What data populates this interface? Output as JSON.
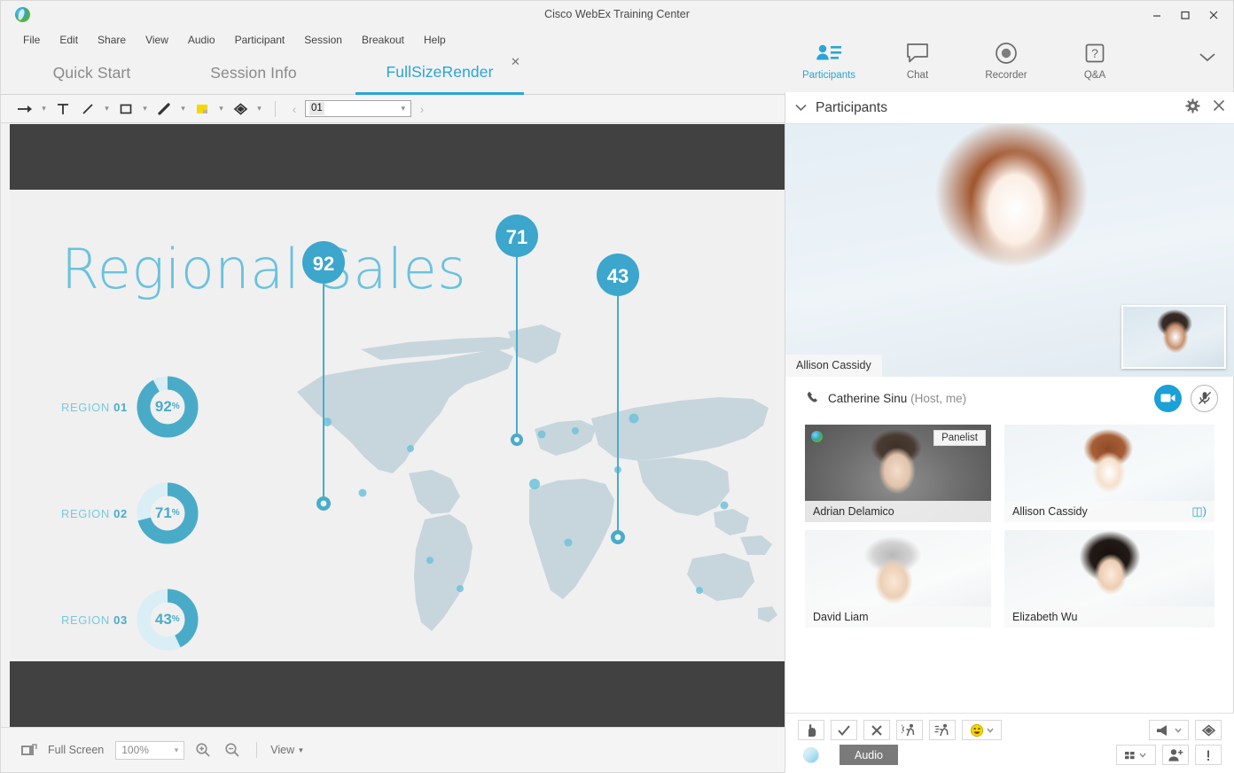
{
  "window": {
    "title": "Cisco WebEx Training Center",
    "logo_icon": "webex-logo-icon",
    "minimize_icon": "minimize-icon",
    "maximize_icon": "maximize-icon",
    "close_icon": "close-icon"
  },
  "menu": {
    "items": [
      "File",
      "Edit",
      "Share",
      "View",
      "Audio",
      "Participant",
      "Session",
      "Breakout",
      "Help"
    ]
  },
  "tabs": {
    "items": [
      {
        "label": "Quick Start",
        "active": false
      },
      {
        "label": "Session Info",
        "active": false
      },
      {
        "label": "FullSizeRender",
        "active": true
      }
    ],
    "close_icon": "close-icon"
  },
  "tool_icons": [
    {
      "label": "Participants",
      "icon": "participants-icon",
      "active": true
    },
    {
      "label": "Chat",
      "icon": "chat-bubble-icon",
      "active": false
    },
    {
      "label": "Recorder",
      "icon": "record-icon",
      "active": false
    },
    {
      "label": "Q&A",
      "icon": "question-box-icon",
      "active": false
    }
  ],
  "tool_icons_more": "chevron-down-icon",
  "annotation_toolbar": {
    "tools": [
      {
        "icon": "pointer-arrow-icon",
        "caret": true
      },
      {
        "icon": "text-tool-icon",
        "caret": false
      },
      {
        "icon": "line-tool-icon",
        "caret": true
      },
      {
        "icon": "rectangle-tool-icon",
        "caret": true
      },
      {
        "icon": "pencil-tool-icon",
        "caret": true
      },
      {
        "icon": "highlighter-tool-icon",
        "caret": true
      },
      {
        "icon": "eraser-tool-icon",
        "caret": true
      }
    ],
    "prev_icon": "chevron-left-icon",
    "next_icon": "chevron-right-icon",
    "page_value": "01",
    "page_caret": "chevron-down-icon"
  },
  "slide": {
    "title": "Regional Sales",
    "accent_color": "#4aabc9",
    "band_color": "#414141",
    "background": "#f0f0f0"
  },
  "chart_data": [
    {
      "type": "pie",
      "title": "Regional Sales",
      "subtype": "donut-gauges",
      "categories": [
        "REGION 01",
        "REGION 02",
        "REGION 03"
      ],
      "values": [
        92,
        71,
        43
      ],
      "unit": "%",
      "max": 100,
      "fill_color": "#4aabc9",
      "track_color": "#d9eef5"
    },
    {
      "type": "scatter",
      "subtype": "world-map-pins",
      "title": "Regional Sales",
      "labels": [
        "92",
        "71",
        "43"
      ],
      "values": [
        92,
        71,
        43
      ],
      "pin_color": "#4aabc9",
      "land_color": "#c7d6dc"
    }
  ],
  "panel": {
    "header": {
      "title": "Participants",
      "collapse_icon": "chevron-down-icon",
      "settings_icon": "gear-icon",
      "close_icon": "close-icon"
    },
    "video": {
      "speaker_name": "Allison Cassidy",
      "pip_present": true
    },
    "host": {
      "name": "Catherine Sinu",
      "role": "(Host, me)",
      "phone_icon": "phone-icon",
      "camera_icon": "video-camera-icon",
      "mic_icon": "mic-muted-icon"
    },
    "participants": [
      {
        "name": "Adrian Delamico",
        "badge": "Panelist",
        "speaking": false,
        "status_dot": true
      },
      {
        "name": "Allison Cassidy",
        "badge": "",
        "speaking": true,
        "status_dot": false
      },
      {
        "name": "David Liam",
        "badge": "",
        "speaking": false,
        "status_dot": false
      },
      {
        "name": "Elizabeth Wu",
        "badge": "",
        "speaking": false,
        "status_dot": false
      }
    ],
    "footer": {
      "feedback_buttons": [
        {
          "icon": "raise-hand-icon"
        },
        {
          "icon": "check-yes-icon"
        },
        {
          "icon": "cross-no-icon"
        },
        {
          "icon": "go-slower-icon"
        },
        {
          "icon": "go-faster-icon"
        },
        {
          "icon": "emoji-icon",
          "caret": true
        }
      ],
      "audio_label": "Audio",
      "webex_ball_icon": "webex-ball-icon",
      "right_row1": [
        {
          "icon": "megaphone-icon",
          "caret": true
        },
        {
          "icon": "eraser-icon"
        }
      ],
      "right_row2": [
        {
          "icon": "grid-view-icon",
          "caret": true
        },
        {
          "icon": "add-person-icon"
        },
        {
          "icon": "alert-exclamation-icon"
        }
      ]
    }
  },
  "statusbar": {
    "fullscreen_icon": "fullscreen-icon",
    "fullscreen_label": "Full Screen",
    "zoom_value": "100%",
    "zoom_caret": "chevron-down-icon",
    "zoom_in_icon": "zoom-in-icon",
    "zoom_out_icon": "zoom-out-icon",
    "view_label": "View",
    "view_caret": "chevron-down-icon"
  }
}
